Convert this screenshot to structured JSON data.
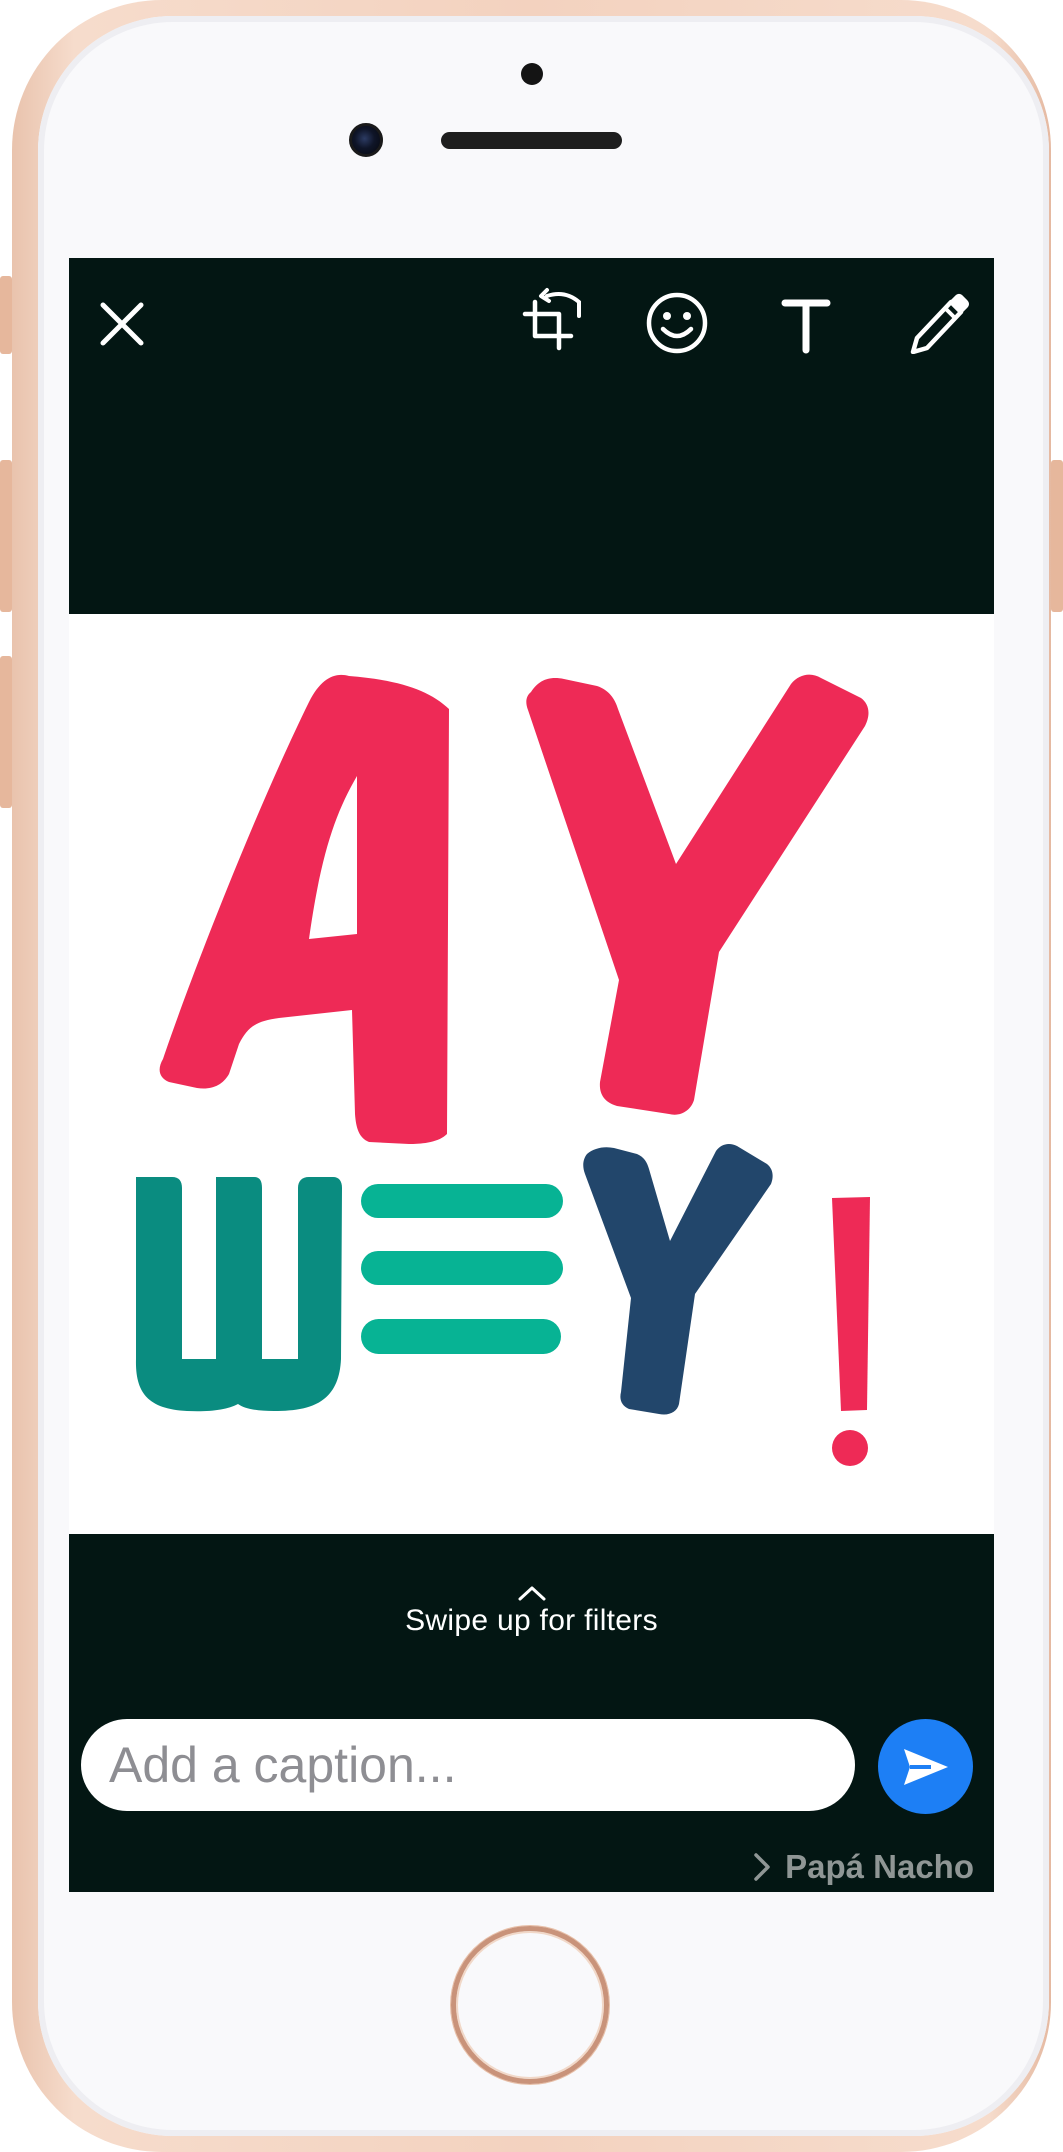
{
  "toolbar": {
    "close_icon": "close-icon",
    "crop_rotate_icon": "crop-rotate-icon",
    "emoji_icon": "emoji-icon",
    "text_icon": "text-icon",
    "text_icon_glyph": "T",
    "draw_icon": "pencil-icon"
  },
  "sticker": {
    "line1": "AY",
    "line2_letters": [
      "W",
      "E",
      "Y",
      "!"
    ],
    "colors": {
      "pink": "#ee2a56",
      "teal_dark": "#0a8c80",
      "teal_light": "#07b394",
      "navy": "#22466b"
    }
  },
  "filters_hint": {
    "chevron_icon": "chevron-up-icon",
    "label": "Swipe up for filters"
  },
  "caption": {
    "placeholder": "Add a caption...",
    "value": ""
  },
  "send_icon": "send-arrow-icon",
  "recipient": {
    "chevron_icon": "chevron-right-icon",
    "name": "Papá Nacho"
  },
  "colors": {
    "screen_bg": "#031613",
    "send_button": "#1d7ff5",
    "frame": "#f3d2bf"
  }
}
